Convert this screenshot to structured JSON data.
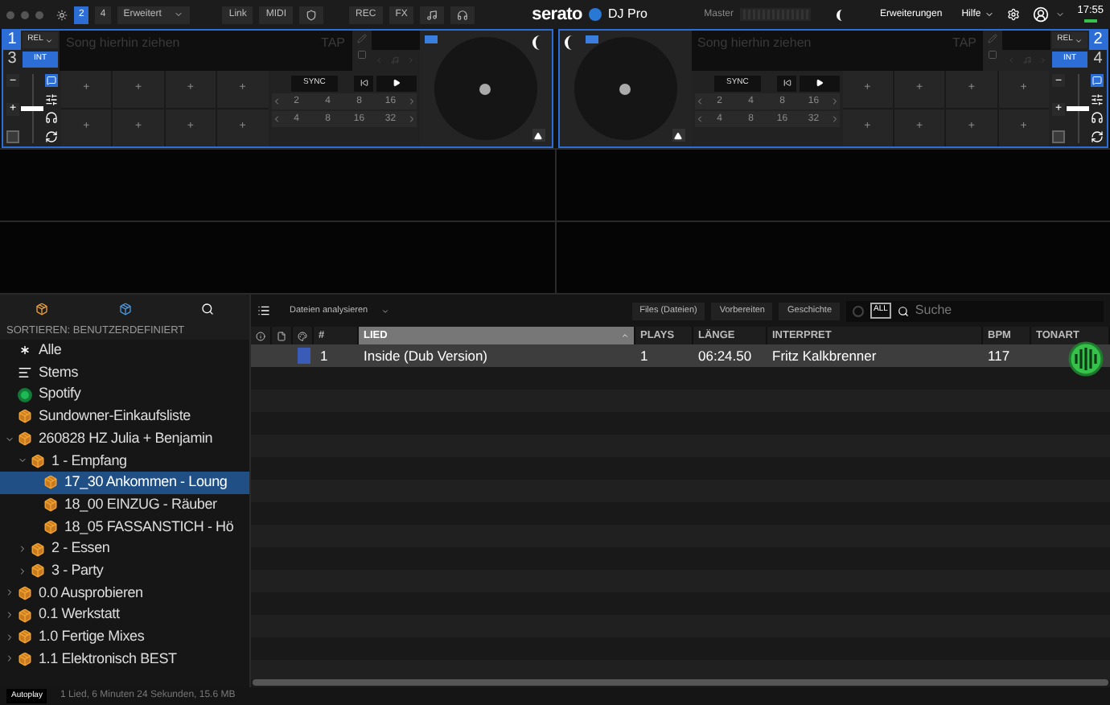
{
  "top_bar": {
    "deck_count_tabs": [
      {
        "label": "2",
        "selected": true
      },
      {
        "label": "4",
        "selected": false
      }
    ],
    "layout_menu": "Erweitert",
    "sync_buttons": [
      "Link",
      "MIDI"
    ],
    "record_buttons": [
      "REC",
      "FX"
    ],
    "logo": "serato",
    "product": "DJ Pro",
    "master": "Master",
    "menus": [
      {
        "label": "Erweiterungen",
        "dropdown": false
      },
      {
        "label": "Hilfe",
        "dropdown": true
      }
    ],
    "time": "17:55"
  },
  "decks": [
    {
      "pitch": {
        "level": 0.5
      },
      "numbers": [
        {
          "label": "1",
          "selected": true
        },
        {
          "label": "3",
          "selected": false
        }
      ],
      "mode": "REL",
      "int": "INT",
      "placeholder": "Song hierhin ziehen",
      "tap": "TAP",
      "sync": "SYNC",
      "pads": [
        "+",
        "+",
        "+",
        "+",
        "+",
        "+",
        "+",
        "+"
      ],
      "loop_rows": [
        [
          "2",
          "4",
          "8",
          "16"
        ],
        [
          "4",
          "8",
          "16",
          "32"
        ]
      ],
      "minus": "−",
      "plus": "+"
    },
    {
      "pitch": {
        "level": 0.5
      },
      "numbers": [
        {
          "label": "2",
          "selected": true
        },
        {
          "label": "4",
          "selected": false
        }
      ],
      "mode": "REL",
      "int": "INT",
      "placeholder": "Song hierhin ziehen",
      "tap": "TAP",
      "sync": "SYNC",
      "pads": [
        "+",
        "+",
        "+",
        "+",
        "+",
        "+",
        "+",
        "+"
      ],
      "loop_rows": [
        [
          "2",
          "4",
          "8",
          "16"
        ],
        [
          "4",
          "8",
          "16",
          "32"
        ]
      ],
      "minus": "−",
      "plus": "+"
    }
  ],
  "sidebar": {
    "sort_label": "SORTIEREN: BENUTZERDEFINIERT",
    "items": [
      {
        "label": "Alle",
        "kind": "all",
        "selected": false
      },
      {
        "label": "Stems",
        "kind": "stems",
        "selected": false
      },
      {
        "label": "Spotify",
        "kind": "spotify",
        "selected": false
      },
      {
        "label": "Sundowner-Einkaufsliste",
        "kind": "crate",
        "selected": false
      },
      {
        "label": "260828 HZ Julia + Benjamin",
        "kind": "crate",
        "selected": false,
        "expanded": true,
        "children": [
          {
            "label": "1 - Empfang",
            "kind": "crate",
            "selected": false,
            "expanded": true,
            "children": [
              {
                "label": "17_30 Ankommen - Loung",
                "kind": "crate",
                "selected": true
              },
              {
                "label": "18_00 EINZUG - Räuber",
                "kind": "crate",
                "selected": false
              },
              {
                "label": "18_05 FASSANSTICH - Hö",
                "kind": "crate",
                "selected": false
              }
            ]
          },
          {
            "label": "2 - Essen",
            "kind": "crate",
            "selected": false,
            "expanded": false
          },
          {
            "label": "3 - Party",
            "kind": "crate",
            "selected": false,
            "expanded": false
          }
        ]
      },
      {
        "label": "0.0 Ausprobieren",
        "kind": "crate",
        "selected": false,
        "expanded": false
      },
      {
        "label": "0.1 Werkstatt",
        "kind": "crate",
        "selected": false,
        "expanded": false
      },
      {
        "label": "1.0 Fertige Mixes",
        "kind": "crate",
        "selected": false,
        "expanded": false
      },
      {
        "label": "1.1 Elektronisch BEST",
        "kind": "crate",
        "selected": false,
        "expanded": false
      }
    ]
  },
  "library": {
    "analyze_menu": "Dateien analysieren",
    "view_tabs": [
      "Files (Dateien)",
      "Vorbereiten",
      "Geschichte"
    ],
    "all_filter": "ALL",
    "search": {
      "placeholder": "Suche"
    },
    "columns": [
      {
        "kind": "icon-info"
      },
      {
        "kind": "icon-file"
      },
      {
        "kind": "icon-color"
      },
      {
        "kind": "text",
        "label": "#"
      },
      {
        "kind": "text",
        "label": "LIED",
        "selected": true
      },
      {
        "kind": "text",
        "label": "PLAYS"
      },
      {
        "kind": "text",
        "label": "LÄNGE"
      },
      {
        "kind": "text",
        "label": "INTERPRET"
      },
      {
        "kind": "text",
        "label": "BPM"
      },
      {
        "kind": "text",
        "label": "TONART"
      }
    ],
    "rows": [
      {
        "color": "#3a5bb8",
        "number": "1",
        "song": "Inside (Dub Version)",
        "plays": "1",
        "length": "06:24.50",
        "artist": "Fritz Kalkbrenner",
        "bpm": "117",
        "selected": true
      }
    ]
  },
  "status_bar": {
    "autoplay": "Autoplay",
    "summary": "1 Lied, 6 Minuten 24 Sekunden, 15.6 MB"
  }
}
